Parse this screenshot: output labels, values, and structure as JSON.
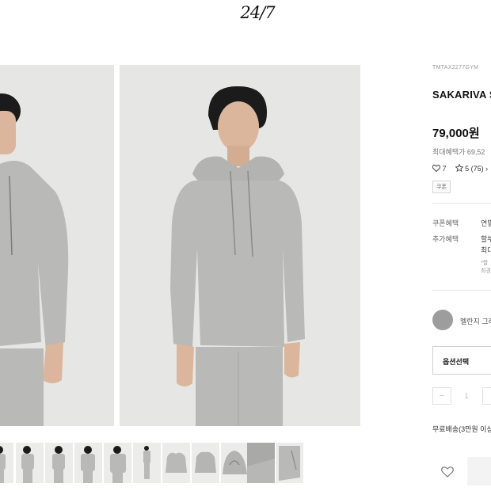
{
  "brand": {
    "logo_text": "24/7"
  },
  "product": {
    "code": "TMTAX2277GYM",
    "title": "SAKARIVA S",
    "price": "79,000원",
    "max_benefit": "최대혜택가 69,52",
    "likes": "7",
    "rating": "5",
    "reviews": "(75) ›",
    "coupon_tag": "쿠폰"
  },
  "benefits": [
    {
      "label": "쿠폰혜택",
      "value": "연말"
    },
    {
      "label": "추가혜택",
      "value": "할부",
      "value2": "최대",
      "notes": [
        "*할",
        "최경"
      ]
    }
  ],
  "color_option": {
    "label": "멜란지 그레",
    "color": "#9d9d9d"
  },
  "option_select": {
    "label": "옵션선택"
  },
  "quantity": {
    "minus": "−",
    "value": "1"
  },
  "shipping": {
    "text": "무료배송(3만원 이상"
  },
  "wishlist": {
    "icon": "heart-icon"
  },
  "colors": {
    "hoodie": "#b9b9b7",
    "photo_bg": "#e6e6e4",
    "hair": "#1b1b1b",
    "skin": "#dcb69c"
  },
  "thumbnails": [
    {
      "view": "model-front",
      "icon": "thumbnail-model"
    },
    {
      "view": "model-side",
      "icon": "thumbnail-model"
    },
    {
      "view": "model-front",
      "icon": "thumbnail-model"
    },
    {
      "view": "model-standing",
      "icon": "thumbnail-model"
    },
    {
      "view": "model-crop",
      "icon": "thumbnail-model"
    },
    {
      "view": "model-full",
      "icon": "thumbnail-model"
    },
    {
      "view": "flat-front",
      "icon": "thumbnail-flat"
    },
    {
      "view": "flat-back",
      "icon": "thumbnail-flat"
    },
    {
      "view": "hood-detail",
      "icon": "thumbnail-detail"
    },
    {
      "view": "fabric-detail",
      "icon": "thumbnail-detail"
    },
    {
      "view": "pocket-detail",
      "icon": "thumbnail-detail"
    }
  ]
}
